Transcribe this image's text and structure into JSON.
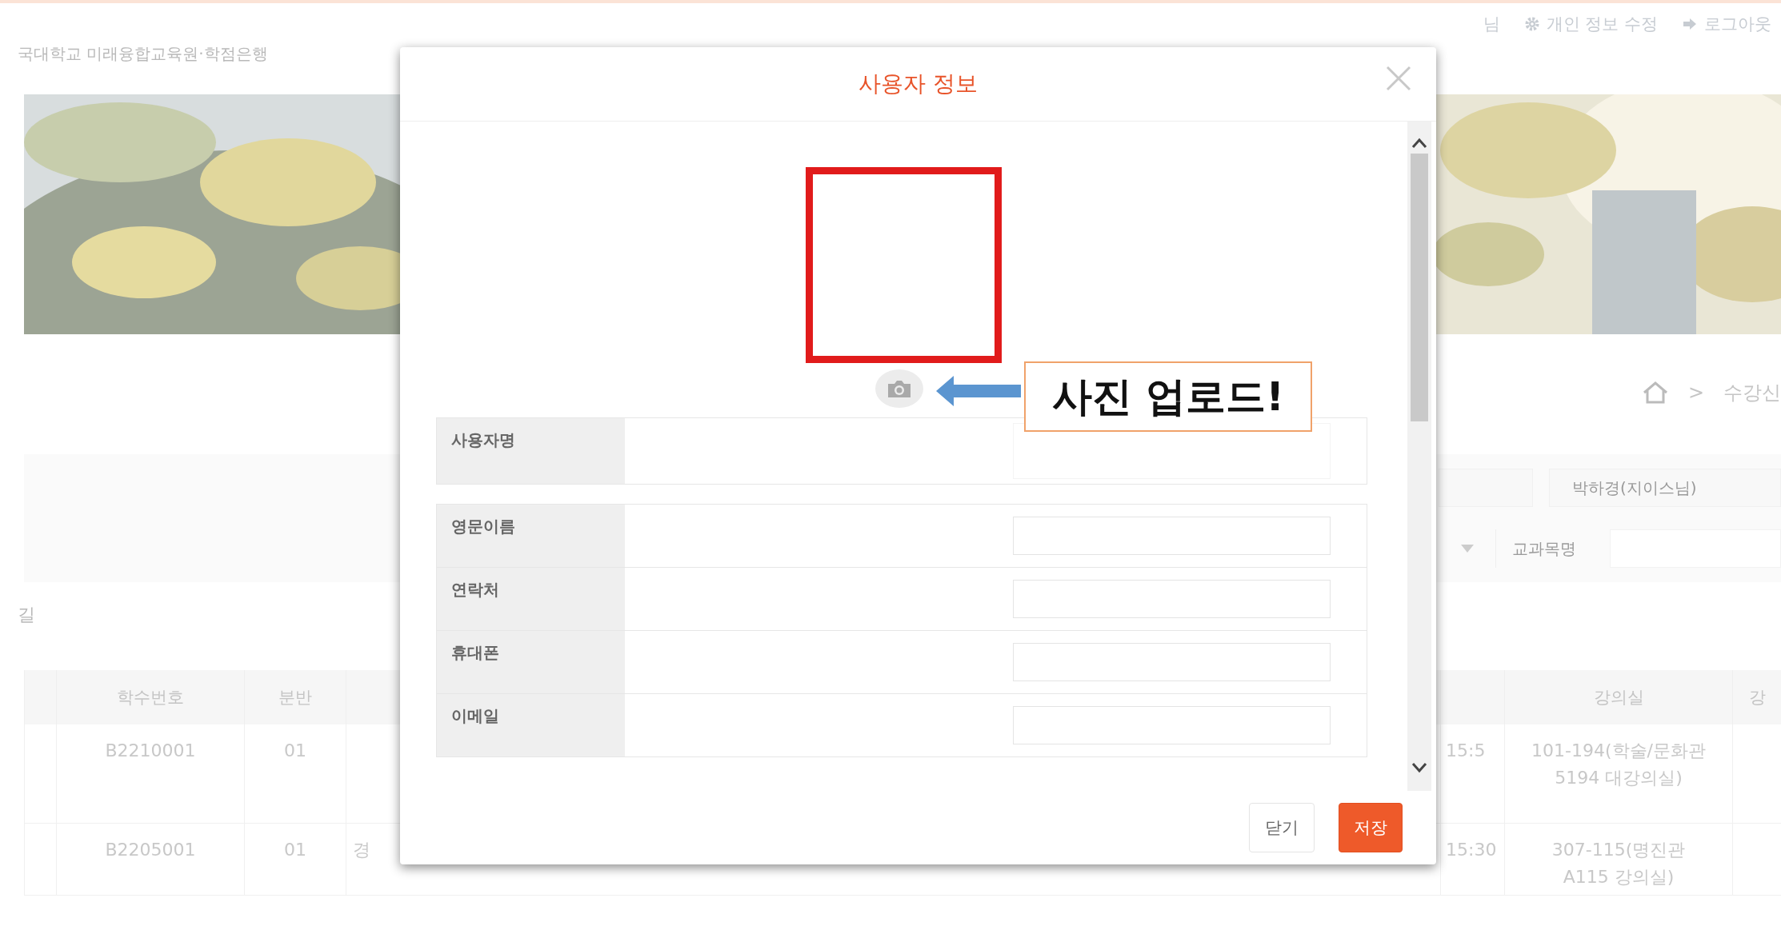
{
  "header": {
    "site_title": "국대학교 미래융합교육원·학점은행",
    "user_suffix": "님",
    "links": [
      {
        "kind": "settings",
        "label": "개인 정보 수정"
      },
      {
        "kind": "logout",
        "label": "로그아웃"
      }
    ]
  },
  "breadcrumb": {
    "separator": ">",
    "current": "수강신"
  },
  "search": {
    "instructor": "박하경(지이스님)",
    "course_label": "교과목명"
  },
  "result_label": "길",
  "table": {
    "columns": [
      "학수번호",
      "분반",
      "강의실",
      "강"
    ],
    "rows": [
      {
        "course_no": "B2210001",
        "section": "01",
        "time": "15:5",
        "room": "101-194(학술/문화관 5194 대강의실)"
      },
      {
        "course_no": "B2205001",
        "section": "01",
        "course_name": "경",
        "time": "15:30",
        "room": "307-115(명진관 A115 강의실)"
      }
    ]
  },
  "modal": {
    "title": "사용자 정보",
    "annotation": "사진 업로드!",
    "field_groups": [
      {
        "fields": [
          {
            "label": "사용자명"
          }
        ]
      },
      {
        "fields": [
          {
            "label": "영문이름"
          },
          {
            "label": "연락처"
          },
          {
            "label": "휴대폰"
          },
          {
            "label": "이메일"
          }
        ]
      }
    ],
    "buttons": [
      {
        "kind": "secondary",
        "label": "닫기"
      },
      {
        "kind": "primary",
        "label": "저장"
      }
    ]
  }
}
